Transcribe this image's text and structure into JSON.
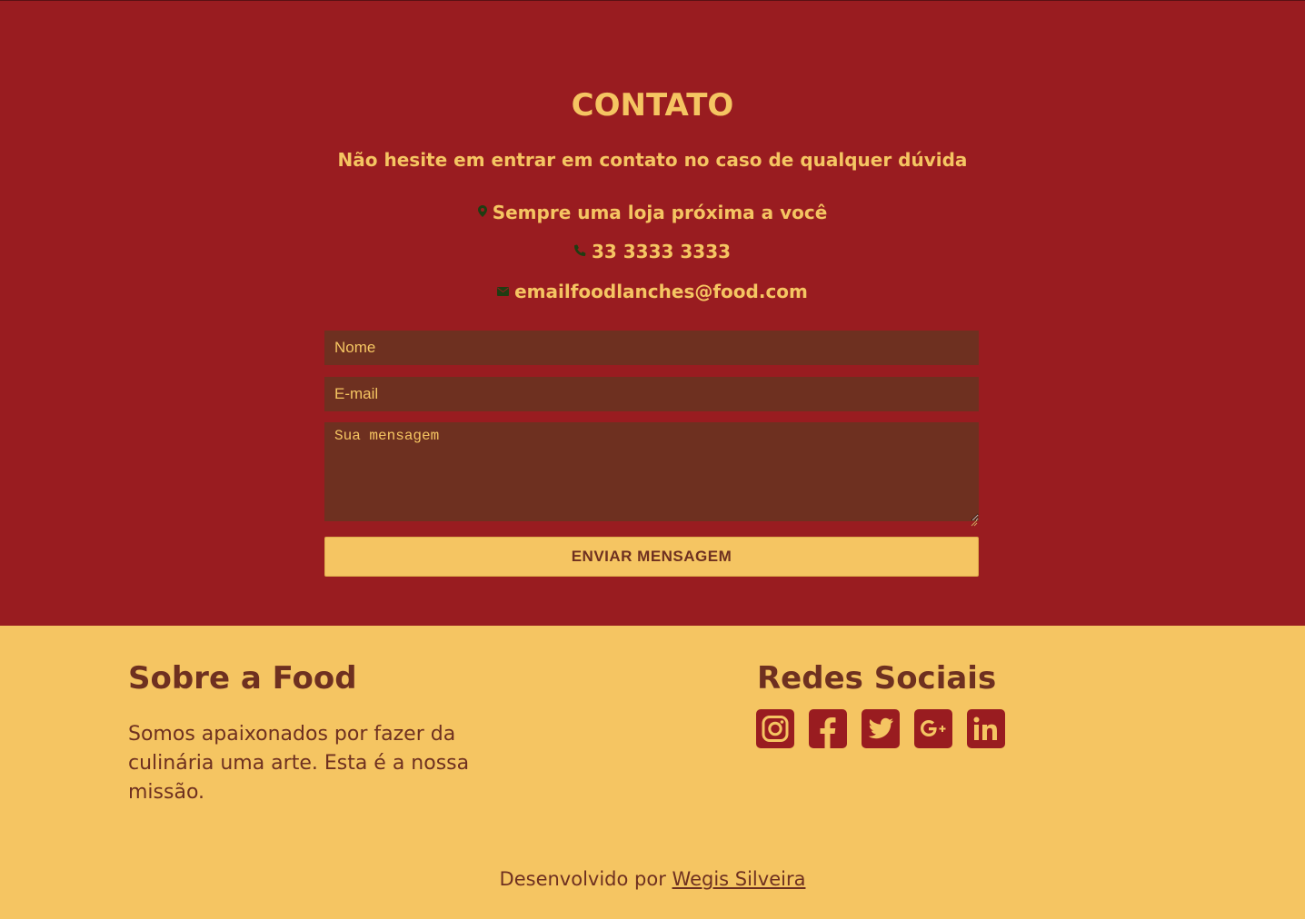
{
  "colors": {
    "contact_bg": "#991c20",
    "accent_yellow": "#f5c562",
    "field_bg": "#6e3020",
    "icon_green": "#1f3d12",
    "footer_text": "#6e3020"
  },
  "contact": {
    "title": "CONTATO",
    "subtitle": "Não hesite em entrar em contato no caso de qualquer dúvida",
    "info": [
      {
        "icon": "map-marker-icon",
        "text": "Sempre uma loja próxima a você"
      },
      {
        "icon": "phone-icon",
        "text": "33 3333 3333"
      },
      {
        "icon": "envelope-icon",
        "text": "emailfoodlanches@food.com"
      }
    ],
    "form": {
      "name_placeholder": "Nome",
      "email_placeholder": "E-mail",
      "message_placeholder": "Sua mensagem",
      "submit_label": "ENVIAR MENSAGEM"
    }
  },
  "footer": {
    "about_title": "Sobre a Food",
    "about_text": "Somos apaixonados por fazer da culinária uma arte. Esta é a nossa missão.",
    "social_title": "Redes Sociais",
    "socials": [
      "instagram-icon",
      "facebook-icon",
      "twitter-icon",
      "google-plus-icon",
      "linkedin-icon"
    ],
    "credit_prefix": "Desenvolvido por",
    "credit_name": "Wegis Silveira"
  }
}
